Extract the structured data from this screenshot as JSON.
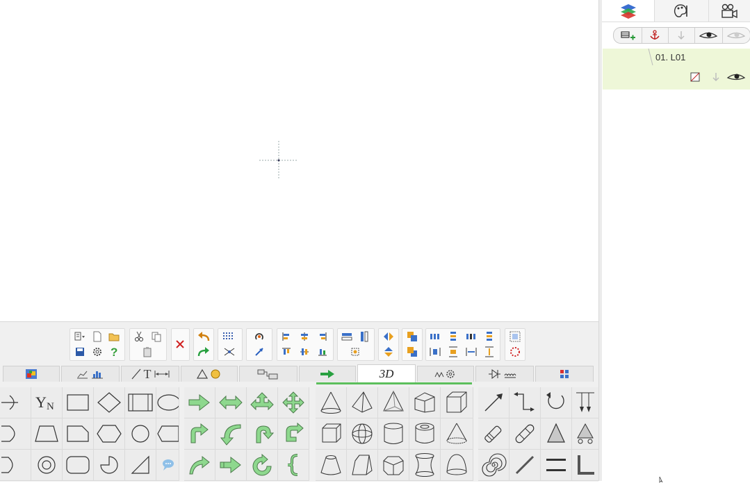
{
  "layers_panel": {
    "tabs": [
      "layers-icon",
      "palette-icon",
      "camera-icon"
    ],
    "toolbar": [
      "add-layer-icon",
      "anchor-icon",
      "move-down-icon",
      "eye-icon",
      "eye-hidden-icon"
    ],
    "layer": {
      "name": "01. L01"
    }
  },
  "toolbar_groups": [
    {
      "name": "file",
      "icons": [
        "menu-icon",
        "new-icon",
        "open-icon",
        "save-icon",
        "settings-icon",
        "help-icon"
      ]
    },
    {
      "name": "clipboard",
      "icons": [
        "cut-icon",
        "copy-icon",
        "paste-icon"
      ]
    },
    {
      "name": "delete",
      "icons": [
        "delete-icon"
      ]
    },
    {
      "name": "history",
      "icons": [
        "undo-icon",
        "redo-icon"
      ]
    },
    {
      "name": "grid",
      "icons": [
        "grid-icon",
        "snap-icon"
      ]
    },
    {
      "name": "rotate",
      "icons": [
        "rotate-icon",
        "flip-icon"
      ]
    },
    {
      "name": "align",
      "icons": [
        "align-left-icon",
        "align-center-icon",
        "align-right-icon",
        "align-top-icon",
        "align-middle-icon",
        "align-bottom-icon"
      ]
    },
    {
      "name": "resize",
      "icons": [
        "same-width-icon",
        "same-height-icon",
        "same-size-icon"
      ]
    },
    {
      "name": "mirror",
      "icons": [
        "mirror-h-icon",
        "mirror-v-icon"
      ]
    },
    {
      "name": "order",
      "icons": [
        "bring-front-icon",
        "send-back-icon"
      ]
    },
    {
      "name": "distribute",
      "icons": [
        "dist-1-icon",
        "dist-2-icon",
        "dist-3-icon",
        "dist-4-icon",
        "dist-5-icon",
        "dist-6-icon",
        "dist-7-icon",
        "dist-8-icon"
      ]
    },
    {
      "name": "group",
      "icons": [
        "group-icon",
        "ungroup-icon"
      ]
    }
  ],
  "category_tabs": [
    {
      "id": "image",
      "label": ""
    },
    {
      "id": "charts",
      "label": ""
    },
    {
      "id": "text",
      "label": "T"
    },
    {
      "id": "shapes",
      "label": ""
    },
    {
      "id": "connectors",
      "label": ""
    },
    {
      "id": "arrows",
      "label": ""
    },
    {
      "id": "3d",
      "label": "3D"
    },
    {
      "id": "mechanical",
      "label": ""
    },
    {
      "id": "electrical",
      "label": ""
    },
    {
      "id": "misc",
      "label": ""
    }
  ],
  "active_tab": "3d"
}
